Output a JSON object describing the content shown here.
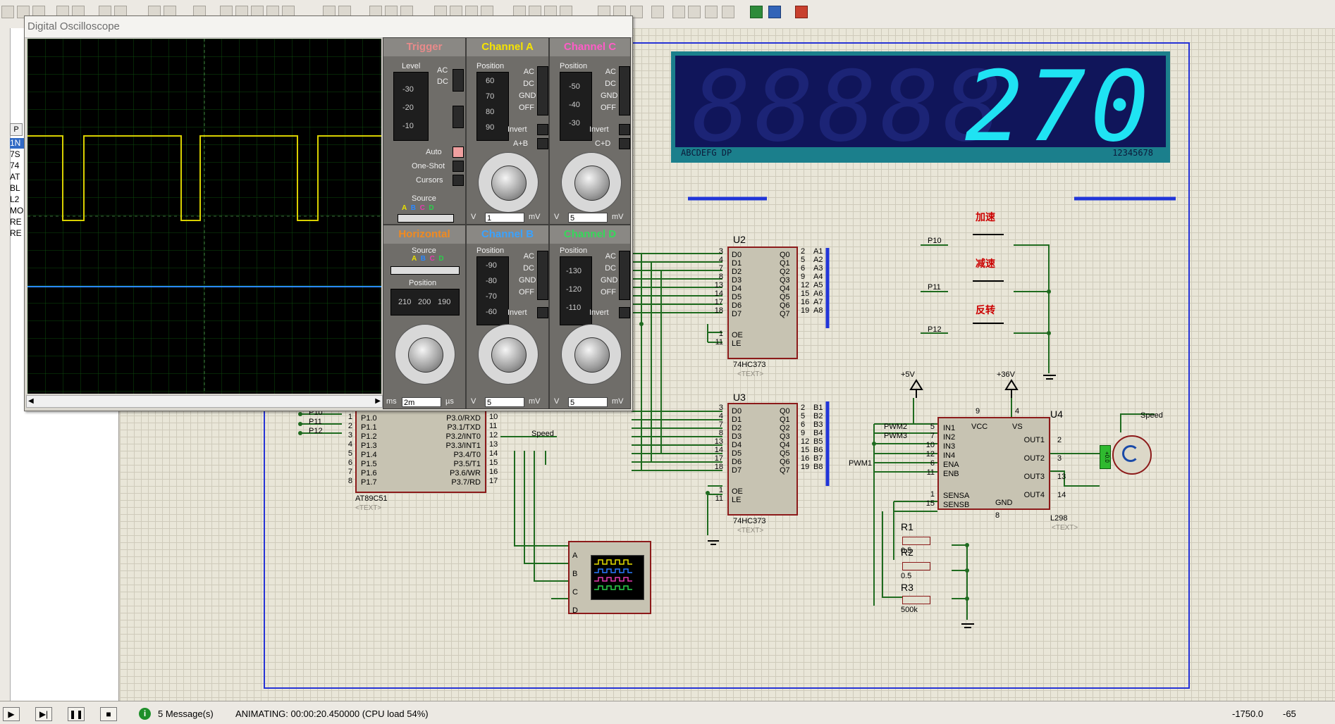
{
  "oscilloscope": {
    "title": "Digital Oscilloscope",
    "trigger": {
      "title": "Trigger",
      "level_label": "Level",
      "level_ticks": [
        "-30",
        "-20",
        "-10"
      ],
      "coupling": [
        "AC",
        "DC"
      ],
      "modes": [
        "Auto",
        "One-Shot",
        "Cursors"
      ],
      "source_label": "Source",
      "sources": [
        "A",
        "B",
        "C",
        "D"
      ]
    },
    "channel_a": {
      "title": "Channel A",
      "position_label": "Position",
      "ticks": [
        "60",
        "70",
        "80",
        "90"
      ],
      "coupling": [
        "AC",
        "DC",
        "GND",
        "OFF"
      ],
      "invert": "Invert",
      "combine": "A+B",
      "scale_value": "1",
      "unit_left": "V",
      "unit_right": "mV"
    },
    "channel_c": {
      "title": "Channel C",
      "position_label": "Position",
      "ticks": [
        "-50",
        "-40",
        "-30"
      ],
      "coupling": [
        "AC",
        "DC",
        "GND",
        "OFF"
      ],
      "invert": "Invert",
      "combine": "C+D",
      "scale_value": "5",
      "unit_left": "V",
      "unit_right": "mV"
    },
    "horizontal": {
      "title": "Horizontal",
      "source_label": "Source",
      "sources": [
        "A",
        "B",
        "C",
        "D"
      ],
      "position_label": "Position",
      "position_ticks": [
        "210",
        "200",
        "190"
      ],
      "scale_value": "2m",
      "unit_left": "ms",
      "unit_right": "µs"
    },
    "channel_b": {
      "title": "Channel B",
      "position_label": "Position",
      "ticks": [
        "-90",
        "-80",
        "-70",
        "-60"
      ],
      "coupling": [
        "AC",
        "DC",
        "GND",
        "OFF"
      ],
      "invert": "Invert",
      "scale_value": "5",
      "unit_left": "V",
      "unit_right": "mV"
    },
    "channel_d": {
      "title": "Channel D",
      "position_label": "Position",
      "ticks": [
        "-130",
        "-120",
        "-110"
      ],
      "coupling": [
        "AC",
        "DC",
        "GND",
        "OFF"
      ],
      "invert": "Invert",
      "scale_value": "5",
      "unit_left": "V",
      "unit_right": "mV"
    }
  },
  "left_panel": {
    "header": "P",
    "items": [
      "1N",
      "7S",
      "74",
      "AT",
      "BL",
      "L2",
      "MO",
      "RE",
      "RE"
    ]
  },
  "lcd": {
    "value": "270",
    "ghost": "88888",
    "footer_left": "ABCDEFG  DP",
    "footer_right": "12345678",
    "pins_left": [
      "A",
      "B",
      "C",
      "D",
      "E",
      "F",
      "G",
      "DP"
    ],
    "pins_right": [
      "B1",
      "B2",
      "B3",
      "B4",
      "B5",
      "B6",
      "B7",
      "B8"
    ]
  },
  "u2": {
    "ref": "U2",
    "part": "74HC373",
    "text": "<TEXT>",
    "inputs": [
      "D0",
      "D1",
      "D2",
      "D3",
      "D4",
      "D5",
      "D6",
      "D7"
    ],
    "outputs": [
      "Q0",
      "Q1",
      "Q2",
      "Q3",
      "Q4",
      "Q5",
      "Q6",
      "Q7"
    ],
    "in_pins": [
      "3",
      "4",
      "7",
      "8",
      "13",
      "14",
      "17",
      "18"
    ],
    "out_pins": [
      "2",
      "5",
      "6",
      "9",
      "12",
      "15",
      "16",
      "19"
    ],
    "out_nets": [
      "A1",
      "A2",
      "A3",
      "A4",
      "A5",
      "A6",
      "A7",
      "A8"
    ],
    "oe": "OE",
    "le": "LE",
    "oe_pin": "1",
    "le_pin": "11"
  },
  "u3": {
    "ref": "U3",
    "part": "74HC373",
    "text": "<TEXT>",
    "inputs": [
      "D0",
      "D1",
      "D2",
      "D3",
      "D4",
      "D5",
      "D6",
      "D7"
    ],
    "outputs": [
      "Q0",
      "Q1",
      "Q2",
      "Q3",
      "Q4",
      "Q5",
      "Q6",
      "Q7"
    ],
    "in_pins": [
      "3",
      "4",
      "7",
      "8",
      "13",
      "14",
      "17",
      "18"
    ],
    "out_pins": [
      "2",
      "5",
      "6",
      "9",
      "12",
      "15",
      "16",
      "19"
    ],
    "out_nets": [
      "B1",
      "B2",
      "B3",
      "B4",
      "B5",
      "B6",
      "B7",
      "B8"
    ],
    "oe": "OE",
    "le": "LE",
    "oe_pin": "1",
    "le_pin": "11"
  },
  "mcu": {
    "part": "AT89C51",
    "text": "<TEXT>",
    "p1": [
      "P1.0",
      "P1.1",
      "P1.2",
      "P1.3",
      "P1.4",
      "P1.5",
      "P1.6",
      "P1.7"
    ],
    "p1_pins": [
      "1",
      "2",
      "3",
      "4",
      "5",
      "6",
      "7",
      "8"
    ],
    "p3": [
      "P3.0/RXD",
      "P3.1/TXD",
      "P3.2/INT0",
      "P3.3/INT1",
      "P3.4/T0",
      "P3.5/T1",
      "P3.6/WR",
      "P3.7/RD"
    ],
    "p3_pins": [
      "10",
      "11",
      "12",
      "13",
      "14",
      "15",
      "16",
      "17"
    ],
    "net_in": [
      "P10",
      "P11",
      "P12"
    ],
    "speed_net": "Speed"
  },
  "buttons": [
    {
      "label": "加速",
      "net": "P10"
    },
    {
      "label": "减速",
      "net": "P11"
    },
    {
      "label": "反转",
      "net": "P12"
    }
  ],
  "l298": {
    "ref": "U4",
    "part": "L298",
    "text": "<TEXT>",
    "left_pins": [
      "IN1",
      "IN2",
      "IN3",
      "IN4",
      "ENA",
      "ENB"
    ],
    "left_nums": [
      "5",
      "7",
      "10",
      "12",
      "6",
      "11"
    ],
    "sense": [
      "SENSA",
      "SENSB"
    ],
    "sense_nums": [
      "1",
      "15"
    ],
    "top": [
      "VCC",
      "VS"
    ],
    "top_nums": [
      "9",
      "4"
    ],
    "right": [
      "OUT1",
      "OUT2",
      "OUT3",
      "OUT4"
    ],
    "right_nums": [
      "2",
      "3",
      "13",
      "14"
    ],
    "gnd": "GND",
    "gnd_num": "8",
    "nets": [
      "PWM2",
      "PWM3",
      "PWM1"
    ]
  },
  "power": {
    "v5": "+5V",
    "v36": "+36V"
  },
  "resistors": [
    {
      "ref": "R1",
      "value": "0.5"
    },
    {
      "ref": "R2",
      "value": "0.5"
    },
    {
      "ref": "R3",
      "value": "500k"
    }
  ],
  "motor": {
    "net": "Speed",
    "reading": "+0.0"
  },
  "scope_box": {
    "inputs": [
      "A",
      "B",
      "C",
      "D"
    ]
  },
  "status": {
    "messages": "5 Message(s)",
    "animating": "ANIMATING: 00:00:20.450000 (CPU load 54%)",
    "coord_x": "-1750.0",
    "coord_y": "-65"
  }
}
